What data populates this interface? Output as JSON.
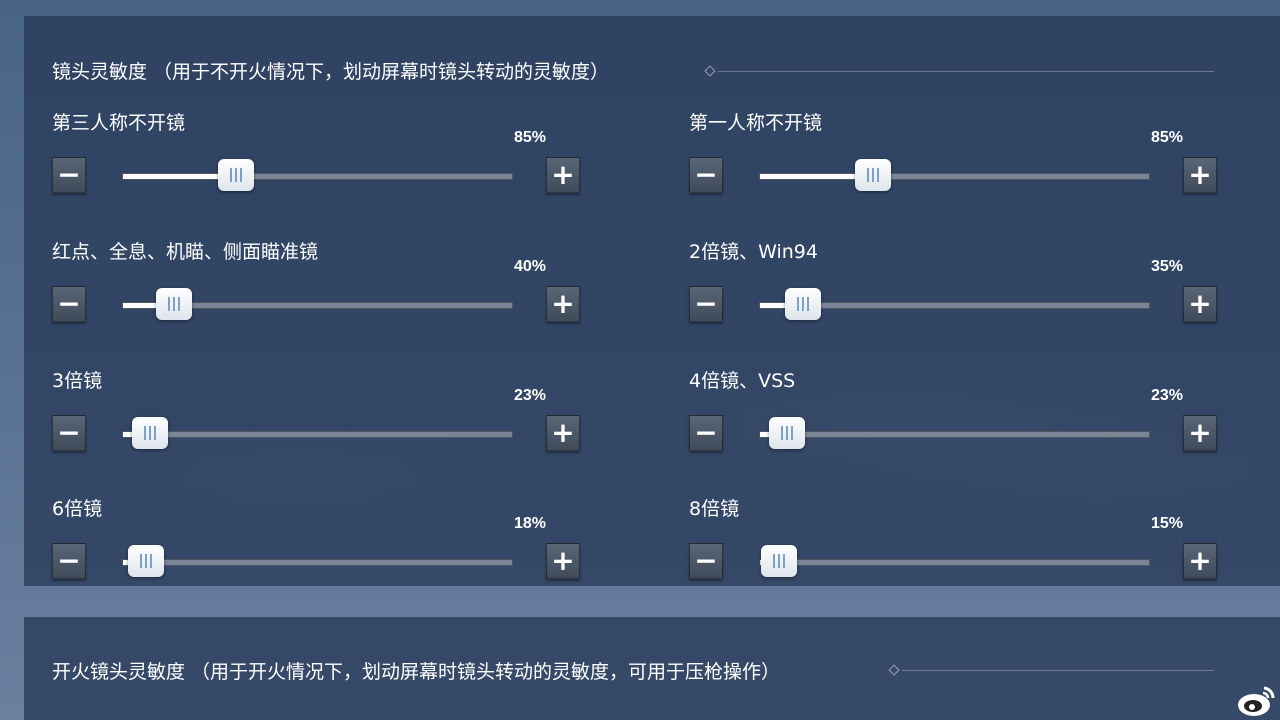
{
  "sections": [
    {
      "title": "镜头灵敏度  （用于不开火情况下，划动屏幕时镜头转动的灵敏度）"
    },
    {
      "title": "开火镜头灵敏度 （用于开火情况下，划动屏幕时镜头转动的灵敏度，可用于压枪操作）"
    }
  ],
  "sliders": [
    {
      "label": "第三人称不开镜",
      "pct": "85%",
      "value": 0.29
    },
    {
      "label": "第一人称不开镜",
      "pct": "85%",
      "value": 0.29
    },
    {
      "label": "红点、全息、机瞄、侧面瞄准镜",
      "pct": "40%",
      "value": 0.13
    },
    {
      "label": "2倍镜、Win94",
      "pct": "35%",
      "value": 0.11
    },
    {
      "label": "3倍镜",
      "pct": "23%",
      "value": 0.07
    },
    {
      "label": "4倍镜、VSS",
      "pct": "23%",
      "value": 0.07
    },
    {
      "label": "6倍镜",
      "pct": "18%",
      "value": 0.06
    },
    {
      "label": "8倍镜",
      "pct": "15%",
      "value": 0.05
    }
  ],
  "buttons": {
    "minus": "−",
    "plus": "+"
  },
  "colors": {
    "panel": "#283a58",
    "fill": "#ffffff",
    "grip": "#7da0c9"
  },
  "watermark_icon": "weibo-logo"
}
